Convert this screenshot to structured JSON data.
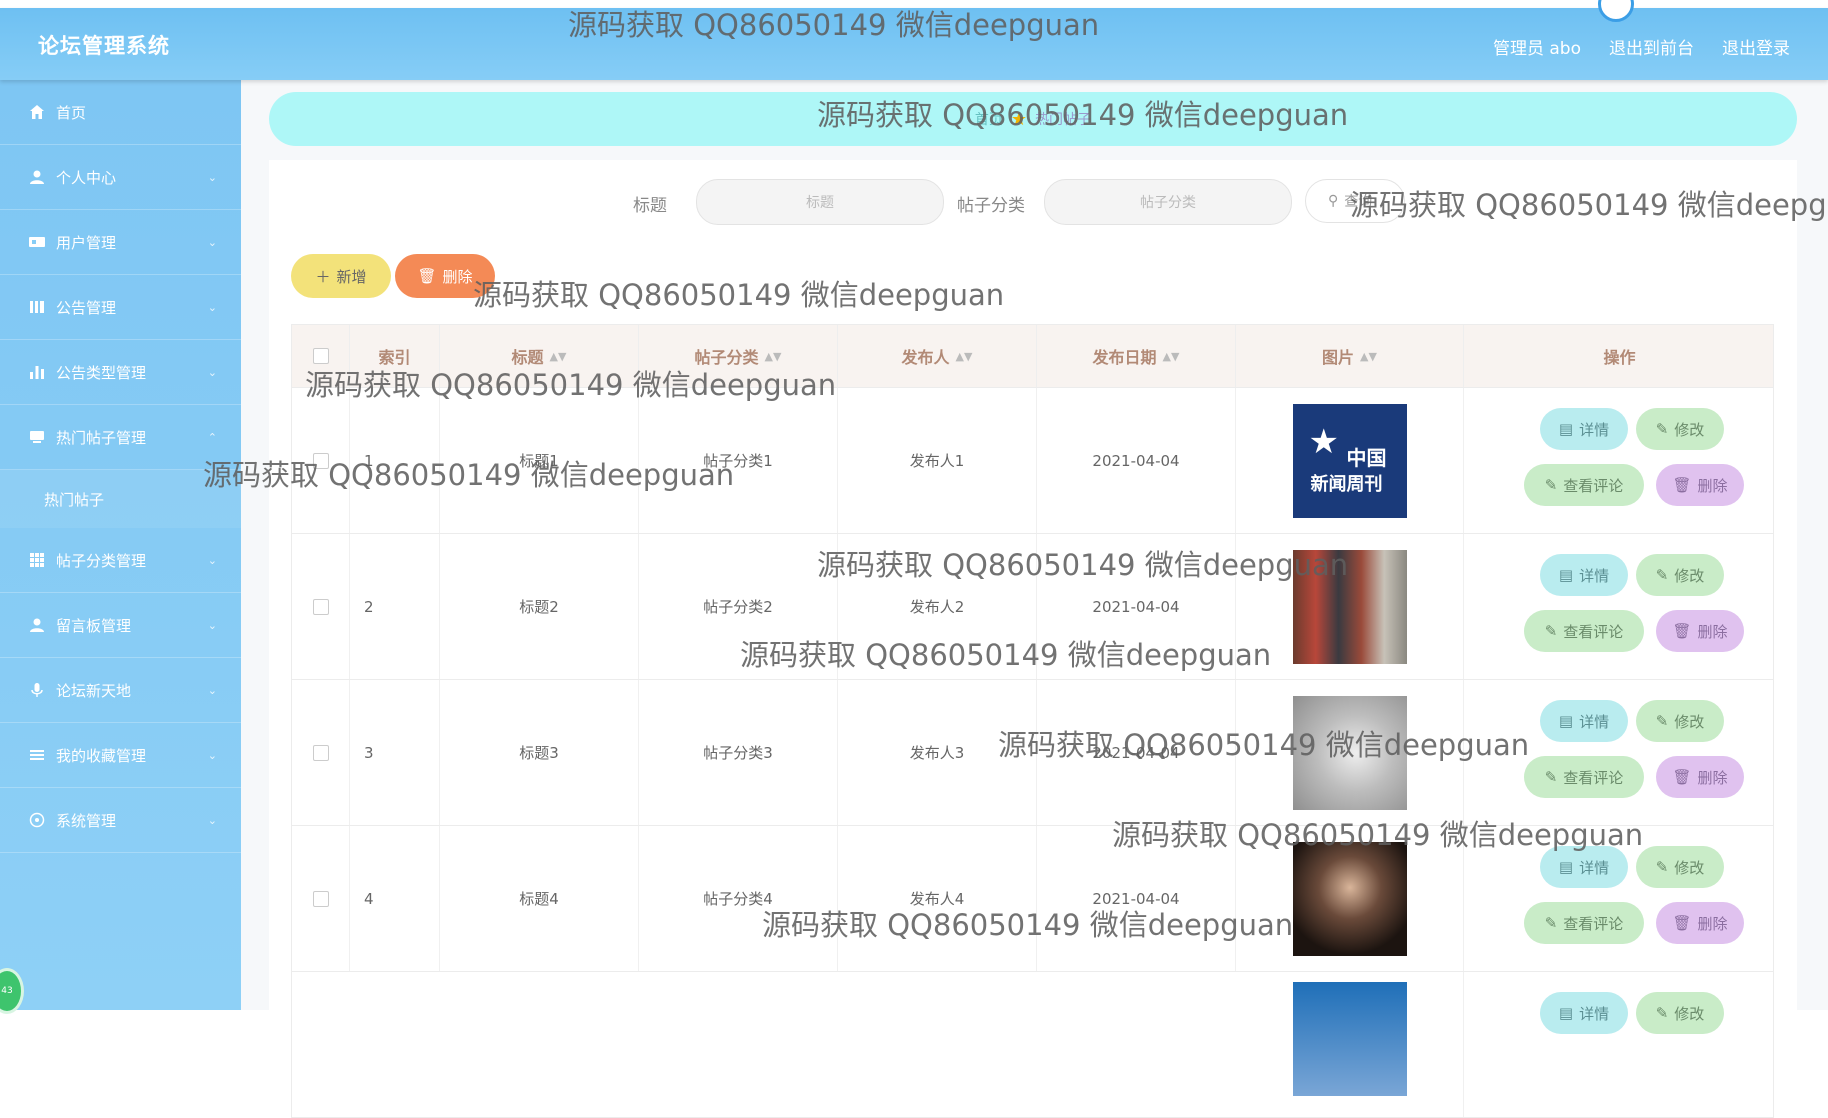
{
  "header": {
    "title": "论坛管理系统",
    "links": [
      "管理员 abo",
      "退出到前台",
      "退出登录"
    ]
  },
  "sidebar": {
    "items": [
      {
        "label": "首页",
        "icon": "home-icon"
      },
      {
        "label": "个人中心",
        "icon": "user-icon"
      },
      {
        "label": "用户管理",
        "icon": "users-icon"
      },
      {
        "label": "公告管理",
        "icon": "notice-icon"
      },
      {
        "label": "公告类型管理",
        "icon": "bar-chart-icon"
      },
      {
        "label": "热门帖子管理",
        "icon": "post-icon"
      },
      {
        "label": "帖子分类管理",
        "icon": "grid-icon"
      },
      {
        "label": "留言板管理",
        "icon": "person-icon"
      },
      {
        "label": "论坛新天地",
        "icon": "mic-icon"
      },
      {
        "label": "我的收藏管理",
        "icon": "list-icon"
      },
      {
        "label": "系统管理",
        "icon": "settings-icon"
      }
    ],
    "submenu_label": "热门帖子",
    "badge": "43"
  },
  "breadcrumb": {
    "home": "首页",
    "current": "热门帖子"
  },
  "search": {
    "title_label": "标题",
    "title_placeholder": "标题",
    "category_label": "帖子分类",
    "category_placeholder": "帖子分类",
    "button_label": "查询"
  },
  "actions": {
    "add_label": "新增",
    "delete_label": "删除"
  },
  "table": {
    "headers": {
      "index": "索引",
      "title": "标题",
      "category": "帖子分类",
      "author": "发布人",
      "date": "发布日期",
      "image": "图片",
      "ops": "操作"
    },
    "rows": [
      {
        "index": "1",
        "title": "标题1",
        "category": "帖子分类1",
        "author": "发布人1",
        "date": "2021-04-04"
      },
      {
        "index": "2",
        "title": "标题2",
        "category": "帖子分类2",
        "author": "发布人2",
        "date": "2021-04-04"
      },
      {
        "index": "3",
        "title": "标题3",
        "category": "帖子分类3",
        "author": "发布人3",
        "date": "2021-04-04"
      },
      {
        "index": "4",
        "title": "标题4",
        "category": "帖子分类4",
        "author": "发布人4",
        "date": "2021-04-04"
      }
    ],
    "op_labels": {
      "detail": "详情",
      "edit": "修改",
      "comment": "查看评论",
      "remove": "删除"
    },
    "logo_line1": "中国",
    "logo_line2": "新闻周刊"
  },
  "watermark": "源码获取 QQ86050149 微信deepguan"
}
